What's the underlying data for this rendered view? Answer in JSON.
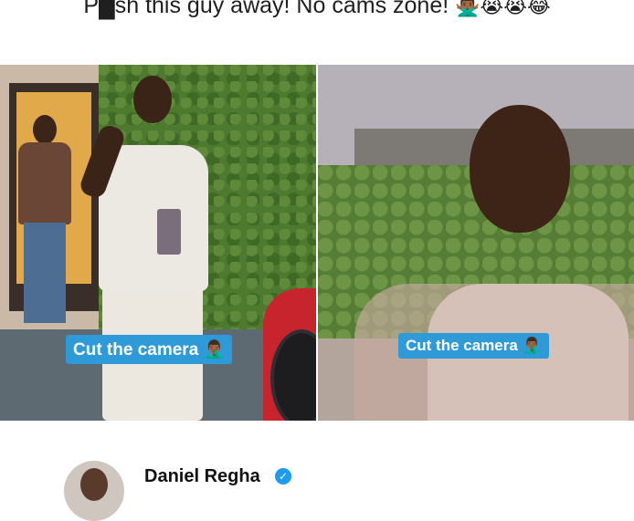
{
  "post": {
    "caption_text": "P█sh this guy away! No cams zone!",
    "caption_emojis": "🙅🏾‍♂️😭😭😂"
  },
  "video_left": {
    "overlay_label": "Cut the camera",
    "overlay_emoji": "🤦🏾‍♂️"
  },
  "video_right": {
    "overlay_label": "Cut the camera",
    "overlay_emoji": "🤦🏾‍♂️"
  },
  "author": {
    "name": "Daniel Regha",
    "verified_icon": "verified-badge-icon",
    "verified_color": "#1d9bf0"
  },
  "colors": {
    "overlay_bg": "#2f9ad8",
    "text_primary": "#1f1f1f"
  }
}
